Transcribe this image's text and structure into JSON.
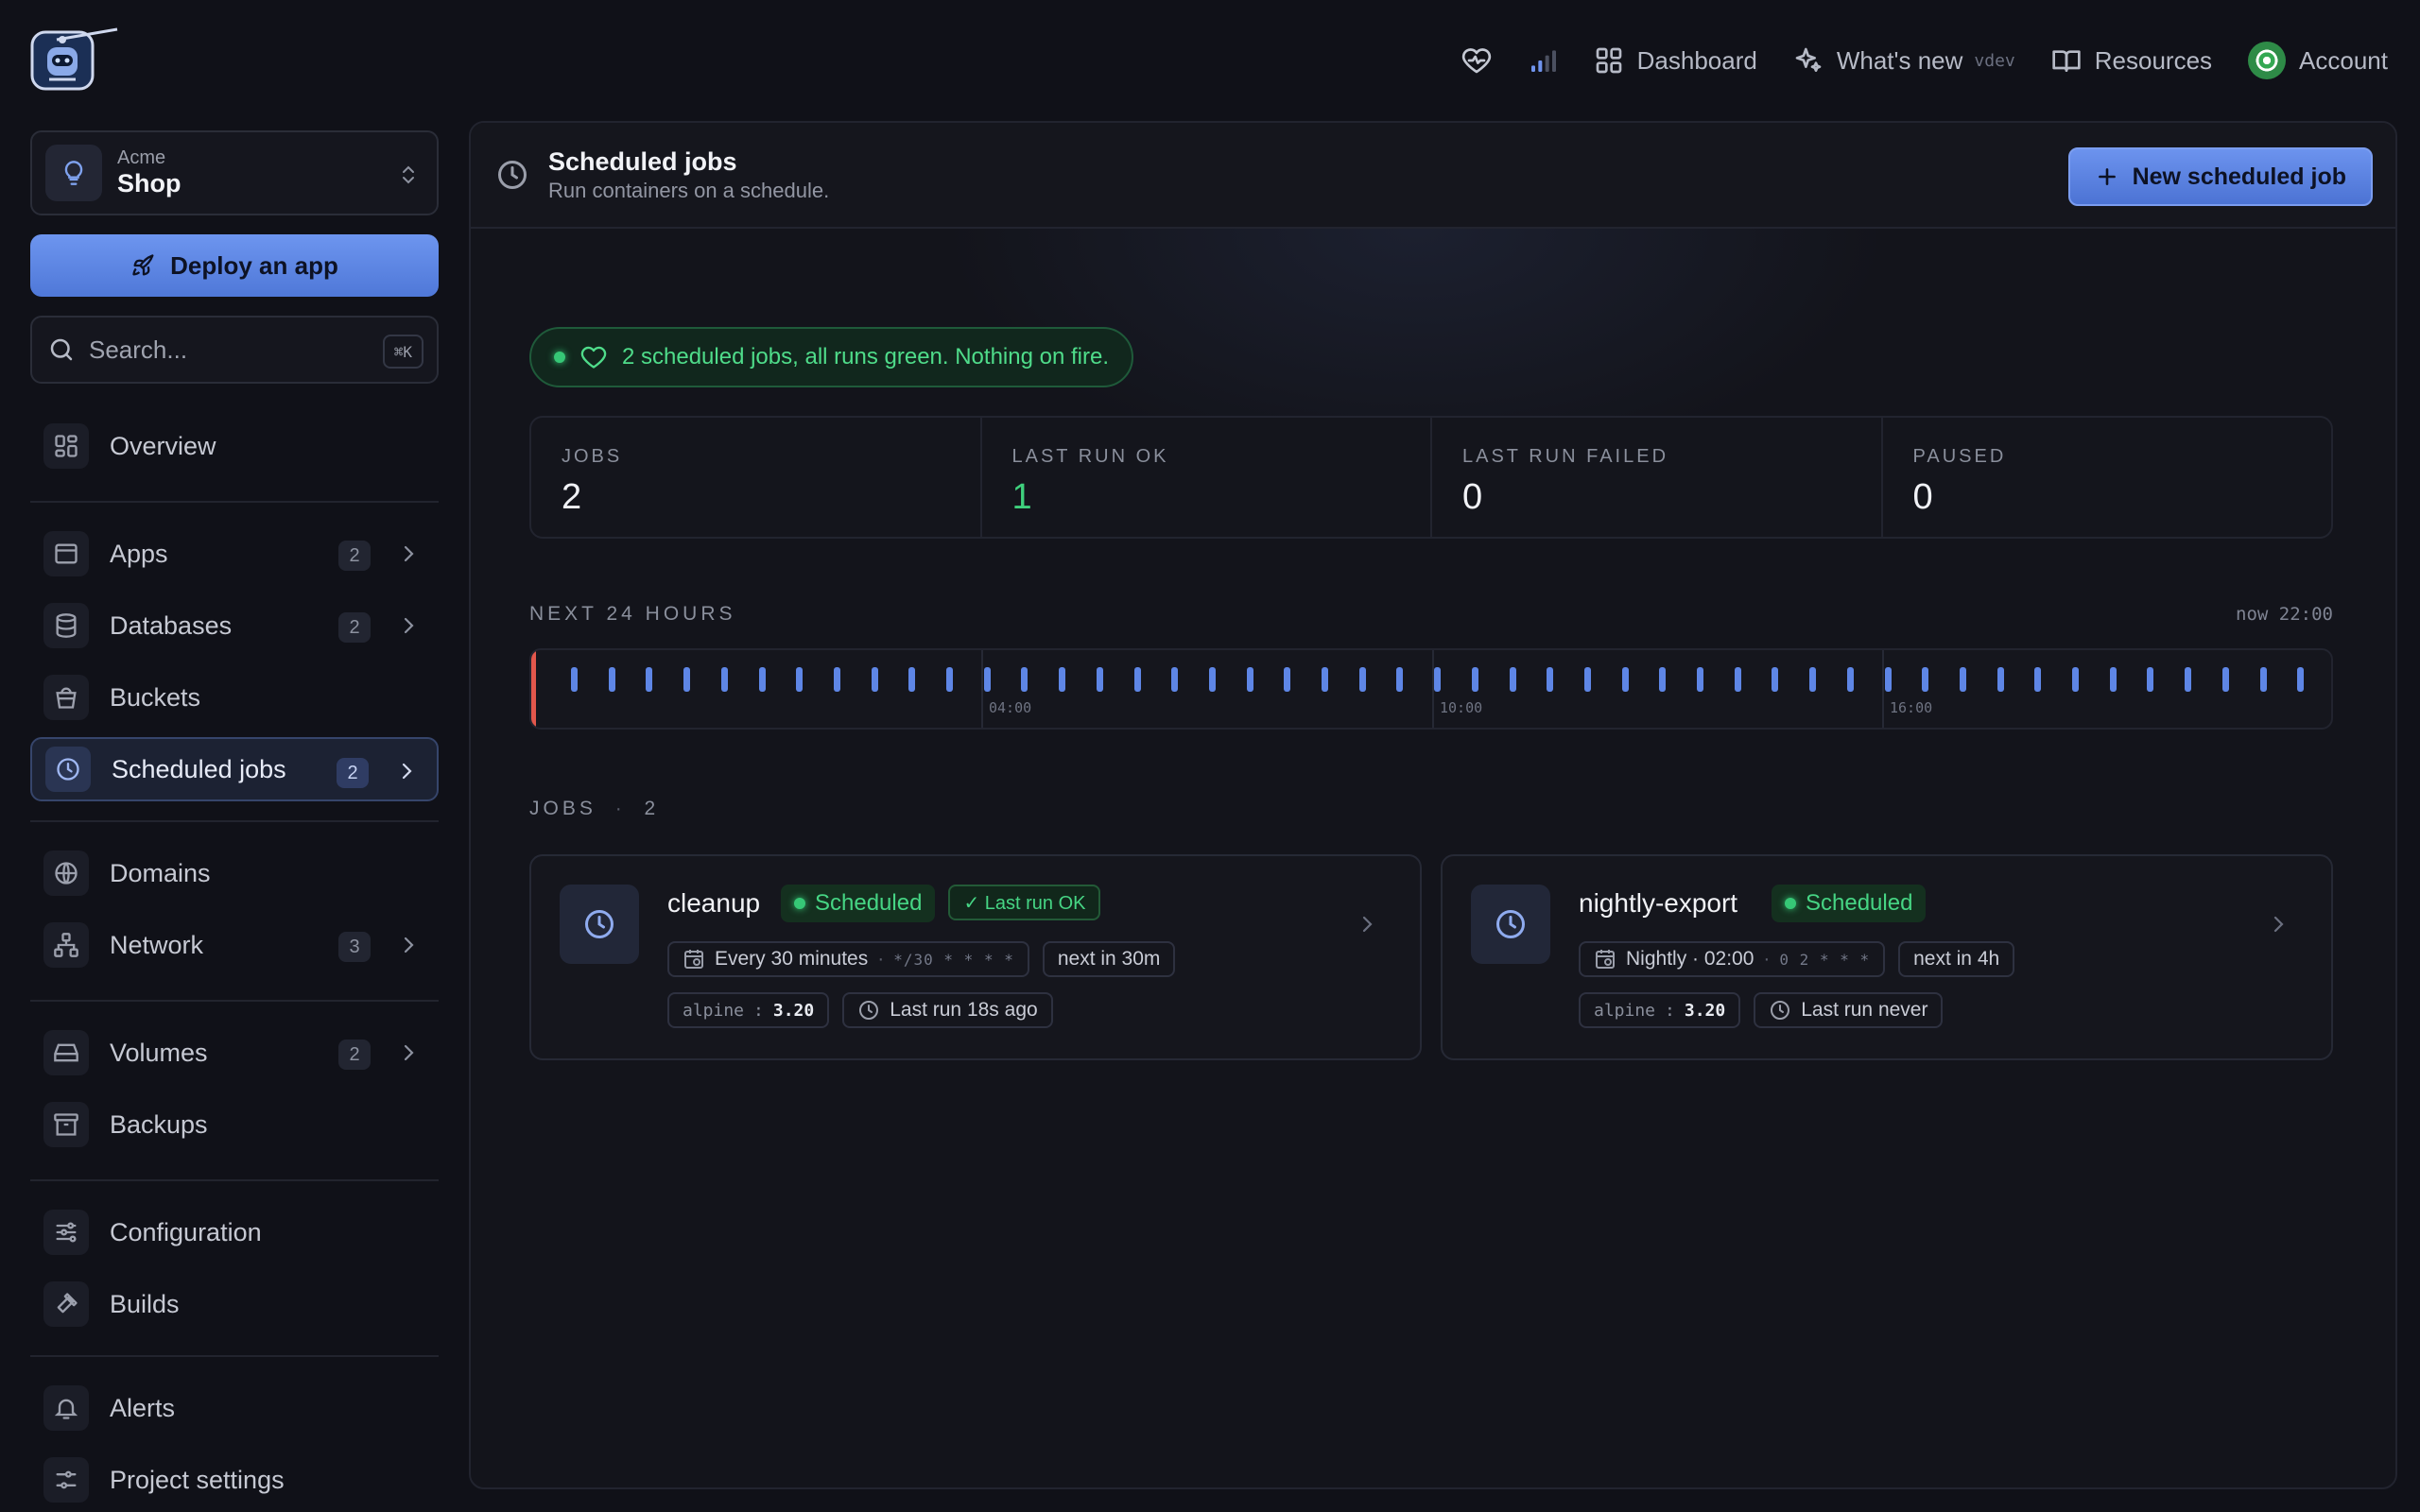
{
  "topnav": {
    "dashboard": "Dashboard",
    "whats_new": "What's new",
    "version": "vdev",
    "resources": "Resources",
    "account": "Account"
  },
  "project": {
    "org": "Acme",
    "name": "Shop"
  },
  "deploy_label": "Deploy an app",
  "search": {
    "placeholder": "Search...",
    "shortcut": "⌘K"
  },
  "sidebar": {
    "items": [
      {
        "label": "Overview",
        "icon": "grid-icon"
      },
      {
        "label": "Apps",
        "badge": "2",
        "icon": "app-window-icon"
      },
      {
        "label": "Databases",
        "badge": "2",
        "icon": "database-icon"
      },
      {
        "label": "Buckets",
        "icon": "bucket-icon"
      },
      {
        "label": "Scheduled jobs",
        "badge": "2",
        "icon": "clock-icon",
        "active": true
      },
      {
        "label": "Domains",
        "icon": "globe-icon"
      },
      {
        "label": "Network",
        "badge": "3",
        "icon": "network-icon"
      },
      {
        "label": "Volumes",
        "badge": "2",
        "icon": "hard-drive-icon"
      },
      {
        "label": "Backups",
        "icon": "archive-icon"
      },
      {
        "label": "Configuration",
        "icon": "sliders-icon"
      },
      {
        "label": "Builds",
        "icon": "hammer-icon"
      },
      {
        "label": "Alerts",
        "icon": "bell-icon"
      },
      {
        "label": "Project settings",
        "icon": "settings-icon"
      }
    ]
  },
  "page": {
    "title": "Scheduled jobs",
    "subtitle": "Run containers on a schedule.",
    "new_button": "New scheduled job"
  },
  "health": "2 scheduled jobs, all runs green. Nothing on fire.",
  "stats": [
    {
      "label": "JOBS",
      "value": "2"
    },
    {
      "label": "LAST RUN OK",
      "value": "1"
    },
    {
      "label": "LAST RUN FAILED",
      "value": "0"
    },
    {
      "label": "PAUSED",
      "value": "0"
    }
  ],
  "timeline": {
    "label": "NEXT 24 HOURS",
    "now": "now 22:00",
    "hour_labels": [
      "04:00",
      "10:00",
      "16:00"
    ]
  },
  "jobs": {
    "label": "JOBS",
    "count": "2",
    "items": [
      {
        "name": "cleanup",
        "status": "Scheduled",
        "last_run_badge": "✓ Last run OK",
        "schedule": "Every 30 minutes",
        "cron": "*/30 * * * *",
        "next": "next in 30m",
        "image": "alpine",
        "tag": "3.20",
        "last_run": "Last run 18s ago"
      },
      {
        "name": "nightly-export",
        "status": "Scheduled",
        "schedule": "Nightly · 02:00",
        "cron": "0 2 * * *",
        "next": "next in 4h",
        "image": "alpine",
        "tag": "3.20",
        "last_run": "Last run never"
      }
    ]
  },
  "colors": {
    "accent": "#5e86e6",
    "success": "#46d584",
    "now_marker": "#e2574c",
    "background": "#101118"
  }
}
